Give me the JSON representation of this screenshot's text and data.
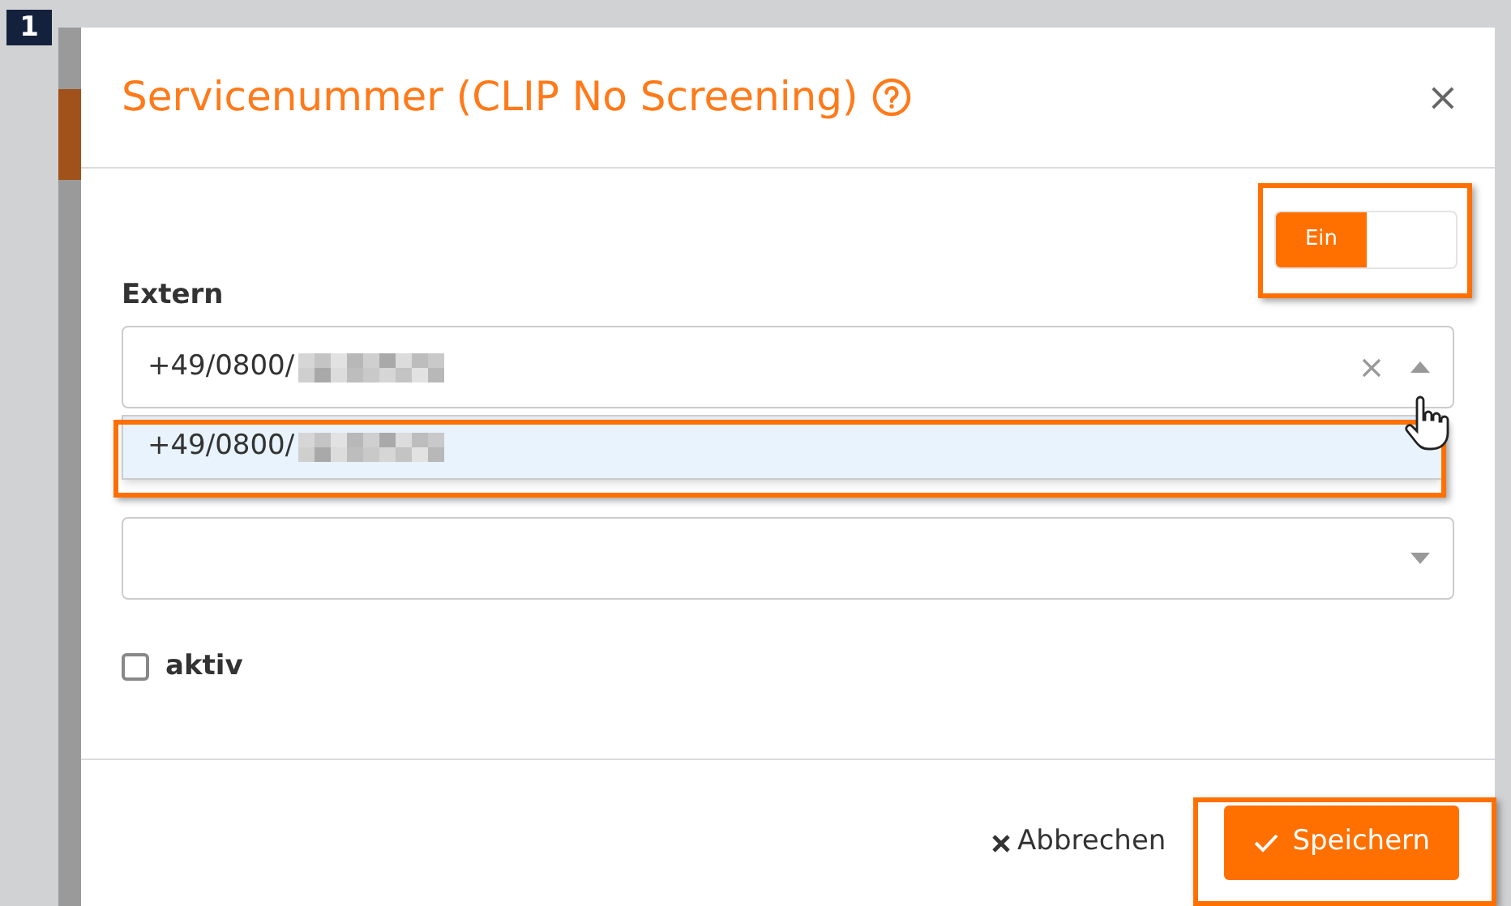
{
  "step_badge": "1",
  "dialog": {
    "title": "Servicenummer (CLIP No Screening)",
    "close": "×",
    "toggle": {
      "label": "Ein",
      "on": true
    },
    "extern": {
      "label": "Extern",
      "value": "+49/0800/",
      "redacted": true,
      "expanded": true,
      "options": [
        {
          "text": "+49/0800/",
          "redacted": true,
          "selected": true
        }
      ]
    },
    "second_select": {
      "expanded": false
    },
    "checkbox": {
      "label": "aktiv",
      "checked": false
    },
    "buttons": [
      {
        "kind": "cancel",
        "label": "Abbrechen"
      },
      {
        "kind": "primary",
        "label": "Speichern"
      }
    ]
  }
}
